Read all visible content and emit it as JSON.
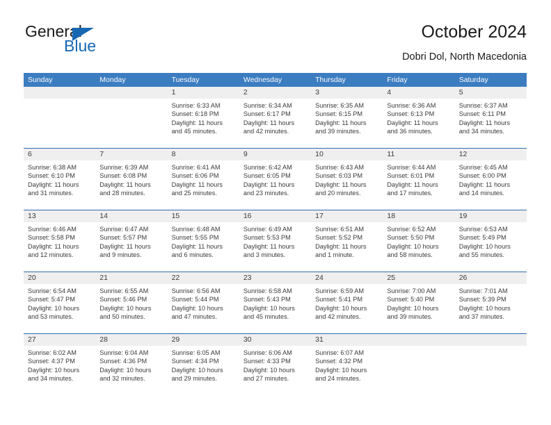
{
  "brand": {
    "name_top": "General",
    "name_bottom": "Blue",
    "accent_color": "#1567b2",
    "logo_icon": "triangle-flag-icon"
  },
  "header": {
    "title": "October 2024",
    "subtitle": "Dobri Dol, North Macedonia"
  },
  "calendar": {
    "header_bg": "#3b7dc0",
    "row_divider_color": "#2b6cad",
    "datebar_bg": "#efefef",
    "weekdays": [
      "Sunday",
      "Monday",
      "Tuesday",
      "Wednesday",
      "Thursday",
      "Friday",
      "Saturday"
    ],
    "weeks": [
      [
        {
          "day": ""
        },
        {
          "day": ""
        },
        {
          "day": "1",
          "sunrise": "Sunrise: 6:33 AM",
          "sunset": "Sunset: 6:18 PM",
          "daylight1": "Daylight: 11 hours",
          "daylight2": "and 45 minutes."
        },
        {
          "day": "2",
          "sunrise": "Sunrise: 6:34 AM",
          "sunset": "Sunset: 6:17 PM",
          "daylight1": "Daylight: 11 hours",
          "daylight2": "and 42 minutes."
        },
        {
          "day": "3",
          "sunrise": "Sunrise: 6:35 AM",
          "sunset": "Sunset: 6:15 PM",
          "daylight1": "Daylight: 11 hours",
          "daylight2": "and 39 minutes."
        },
        {
          "day": "4",
          "sunrise": "Sunrise: 6:36 AM",
          "sunset": "Sunset: 6:13 PM",
          "daylight1": "Daylight: 11 hours",
          "daylight2": "and 36 minutes."
        },
        {
          "day": "5",
          "sunrise": "Sunrise: 6:37 AM",
          "sunset": "Sunset: 6:11 PM",
          "daylight1": "Daylight: 11 hours",
          "daylight2": "and 34 minutes."
        }
      ],
      [
        {
          "day": "6",
          "sunrise": "Sunrise: 6:38 AM",
          "sunset": "Sunset: 6:10 PM",
          "daylight1": "Daylight: 11 hours",
          "daylight2": "and 31 minutes."
        },
        {
          "day": "7",
          "sunrise": "Sunrise: 6:39 AM",
          "sunset": "Sunset: 6:08 PM",
          "daylight1": "Daylight: 11 hours",
          "daylight2": "and 28 minutes."
        },
        {
          "day": "8",
          "sunrise": "Sunrise: 6:41 AM",
          "sunset": "Sunset: 6:06 PM",
          "daylight1": "Daylight: 11 hours",
          "daylight2": "and 25 minutes."
        },
        {
          "day": "9",
          "sunrise": "Sunrise: 6:42 AM",
          "sunset": "Sunset: 6:05 PM",
          "daylight1": "Daylight: 11 hours",
          "daylight2": "and 23 minutes."
        },
        {
          "day": "10",
          "sunrise": "Sunrise: 6:43 AM",
          "sunset": "Sunset: 6:03 PM",
          "daylight1": "Daylight: 11 hours",
          "daylight2": "and 20 minutes."
        },
        {
          "day": "11",
          "sunrise": "Sunrise: 6:44 AM",
          "sunset": "Sunset: 6:01 PM",
          "daylight1": "Daylight: 11 hours",
          "daylight2": "and 17 minutes."
        },
        {
          "day": "12",
          "sunrise": "Sunrise: 6:45 AM",
          "sunset": "Sunset: 6:00 PM",
          "daylight1": "Daylight: 11 hours",
          "daylight2": "and 14 minutes."
        }
      ],
      [
        {
          "day": "13",
          "sunrise": "Sunrise: 6:46 AM",
          "sunset": "Sunset: 5:58 PM",
          "daylight1": "Daylight: 11 hours",
          "daylight2": "and 12 minutes."
        },
        {
          "day": "14",
          "sunrise": "Sunrise: 6:47 AM",
          "sunset": "Sunset: 5:57 PM",
          "daylight1": "Daylight: 11 hours",
          "daylight2": "and 9 minutes."
        },
        {
          "day": "15",
          "sunrise": "Sunrise: 6:48 AM",
          "sunset": "Sunset: 5:55 PM",
          "daylight1": "Daylight: 11 hours",
          "daylight2": "and 6 minutes."
        },
        {
          "day": "16",
          "sunrise": "Sunrise: 6:49 AM",
          "sunset": "Sunset: 5:53 PM",
          "daylight1": "Daylight: 11 hours",
          "daylight2": "and 3 minutes."
        },
        {
          "day": "17",
          "sunrise": "Sunrise: 6:51 AM",
          "sunset": "Sunset: 5:52 PM",
          "daylight1": "Daylight: 11 hours",
          "daylight2": "and 1 minute."
        },
        {
          "day": "18",
          "sunrise": "Sunrise: 6:52 AM",
          "sunset": "Sunset: 5:50 PM",
          "daylight1": "Daylight: 10 hours",
          "daylight2": "and 58 minutes."
        },
        {
          "day": "19",
          "sunrise": "Sunrise: 6:53 AM",
          "sunset": "Sunset: 5:49 PM",
          "daylight1": "Daylight: 10 hours",
          "daylight2": "and 55 minutes."
        }
      ],
      [
        {
          "day": "20",
          "sunrise": "Sunrise: 6:54 AM",
          "sunset": "Sunset: 5:47 PM",
          "daylight1": "Daylight: 10 hours",
          "daylight2": "and 53 minutes."
        },
        {
          "day": "21",
          "sunrise": "Sunrise: 6:55 AM",
          "sunset": "Sunset: 5:46 PM",
          "daylight1": "Daylight: 10 hours",
          "daylight2": "and 50 minutes."
        },
        {
          "day": "22",
          "sunrise": "Sunrise: 6:56 AM",
          "sunset": "Sunset: 5:44 PM",
          "daylight1": "Daylight: 10 hours",
          "daylight2": "and 47 minutes."
        },
        {
          "day": "23",
          "sunrise": "Sunrise: 6:58 AM",
          "sunset": "Sunset: 5:43 PM",
          "daylight1": "Daylight: 10 hours",
          "daylight2": "and 45 minutes."
        },
        {
          "day": "24",
          "sunrise": "Sunrise: 6:59 AM",
          "sunset": "Sunset: 5:41 PM",
          "daylight1": "Daylight: 10 hours",
          "daylight2": "and 42 minutes."
        },
        {
          "day": "25",
          "sunrise": "Sunrise: 7:00 AM",
          "sunset": "Sunset: 5:40 PM",
          "daylight1": "Daylight: 10 hours",
          "daylight2": "and 39 minutes."
        },
        {
          "day": "26",
          "sunrise": "Sunrise: 7:01 AM",
          "sunset": "Sunset: 5:39 PM",
          "daylight1": "Daylight: 10 hours",
          "daylight2": "and 37 minutes."
        }
      ],
      [
        {
          "day": "27",
          "sunrise": "Sunrise: 6:02 AM",
          "sunset": "Sunset: 4:37 PM",
          "daylight1": "Daylight: 10 hours",
          "daylight2": "and 34 minutes."
        },
        {
          "day": "28",
          "sunrise": "Sunrise: 6:04 AM",
          "sunset": "Sunset: 4:36 PM",
          "daylight1": "Daylight: 10 hours",
          "daylight2": "and 32 minutes."
        },
        {
          "day": "29",
          "sunrise": "Sunrise: 6:05 AM",
          "sunset": "Sunset: 4:34 PM",
          "daylight1": "Daylight: 10 hours",
          "daylight2": "and 29 minutes."
        },
        {
          "day": "30",
          "sunrise": "Sunrise: 6:06 AM",
          "sunset": "Sunset: 4:33 PM",
          "daylight1": "Daylight: 10 hours",
          "daylight2": "and 27 minutes."
        },
        {
          "day": "31",
          "sunrise": "Sunrise: 6:07 AM",
          "sunset": "Sunset: 4:32 PM",
          "daylight1": "Daylight: 10 hours",
          "daylight2": "and 24 minutes."
        },
        {
          "day": ""
        },
        {
          "day": ""
        }
      ]
    ]
  }
}
